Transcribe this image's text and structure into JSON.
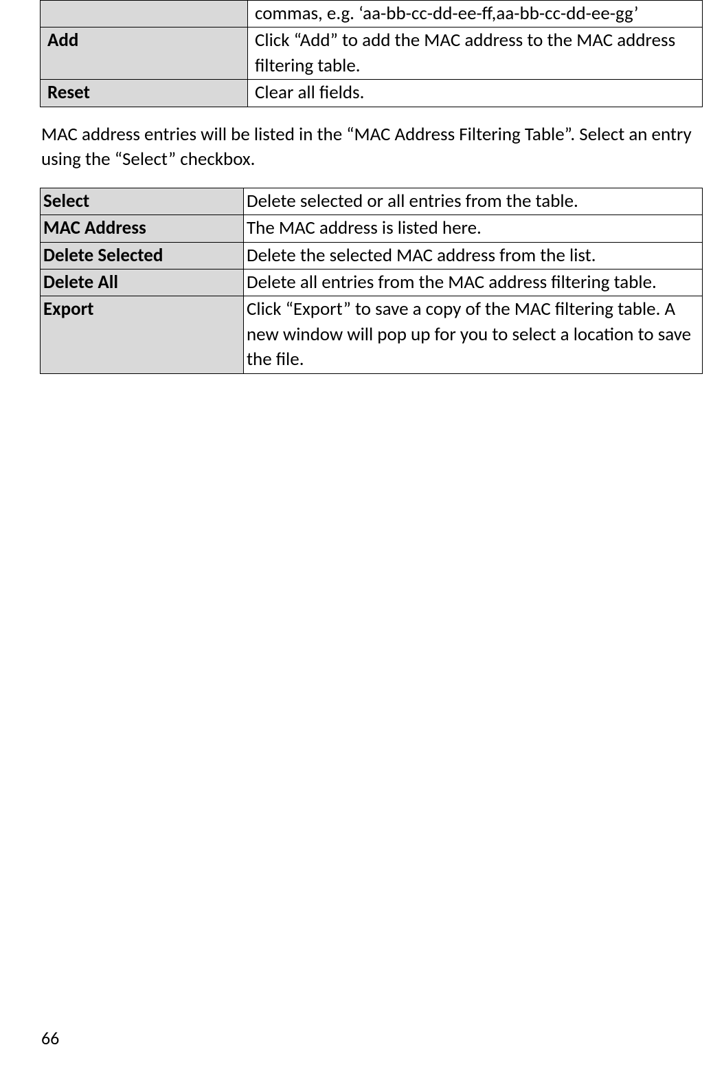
{
  "table1": {
    "rows": [
      {
        "label": "",
        "desc": "commas, e.g. ‘aa-bb-cc-dd-ee-ff,aa-bb-cc-dd-ee-gg’"
      },
      {
        "label": "Add",
        "desc": "Click “Add” to add the MAC address to the MAC address filtering table."
      },
      {
        "label": "Reset",
        "desc": "Clear all fields."
      }
    ]
  },
  "paragraph": "MAC address entries will be listed in the “MAC Address Filtering Table”. Select an entry using the “Select” checkbox.",
  "table2": {
    "rows": [
      {
        "label": "Select",
        "desc": "Delete selected or all entries from the table."
      },
      {
        "label": "MAC Address",
        "desc": "The MAC address is listed here."
      },
      {
        "label": "Delete Selected",
        "desc": "Delete the selected MAC address from the list."
      },
      {
        "label": "Delete All",
        "desc": "Delete all entries from the MAC address filtering table."
      },
      {
        "label": "Export",
        "desc": "Click “Export” to save a copy of the MAC filtering table. A new window will pop up for you to select a location to save the file."
      }
    ]
  },
  "page_number": "66"
}
